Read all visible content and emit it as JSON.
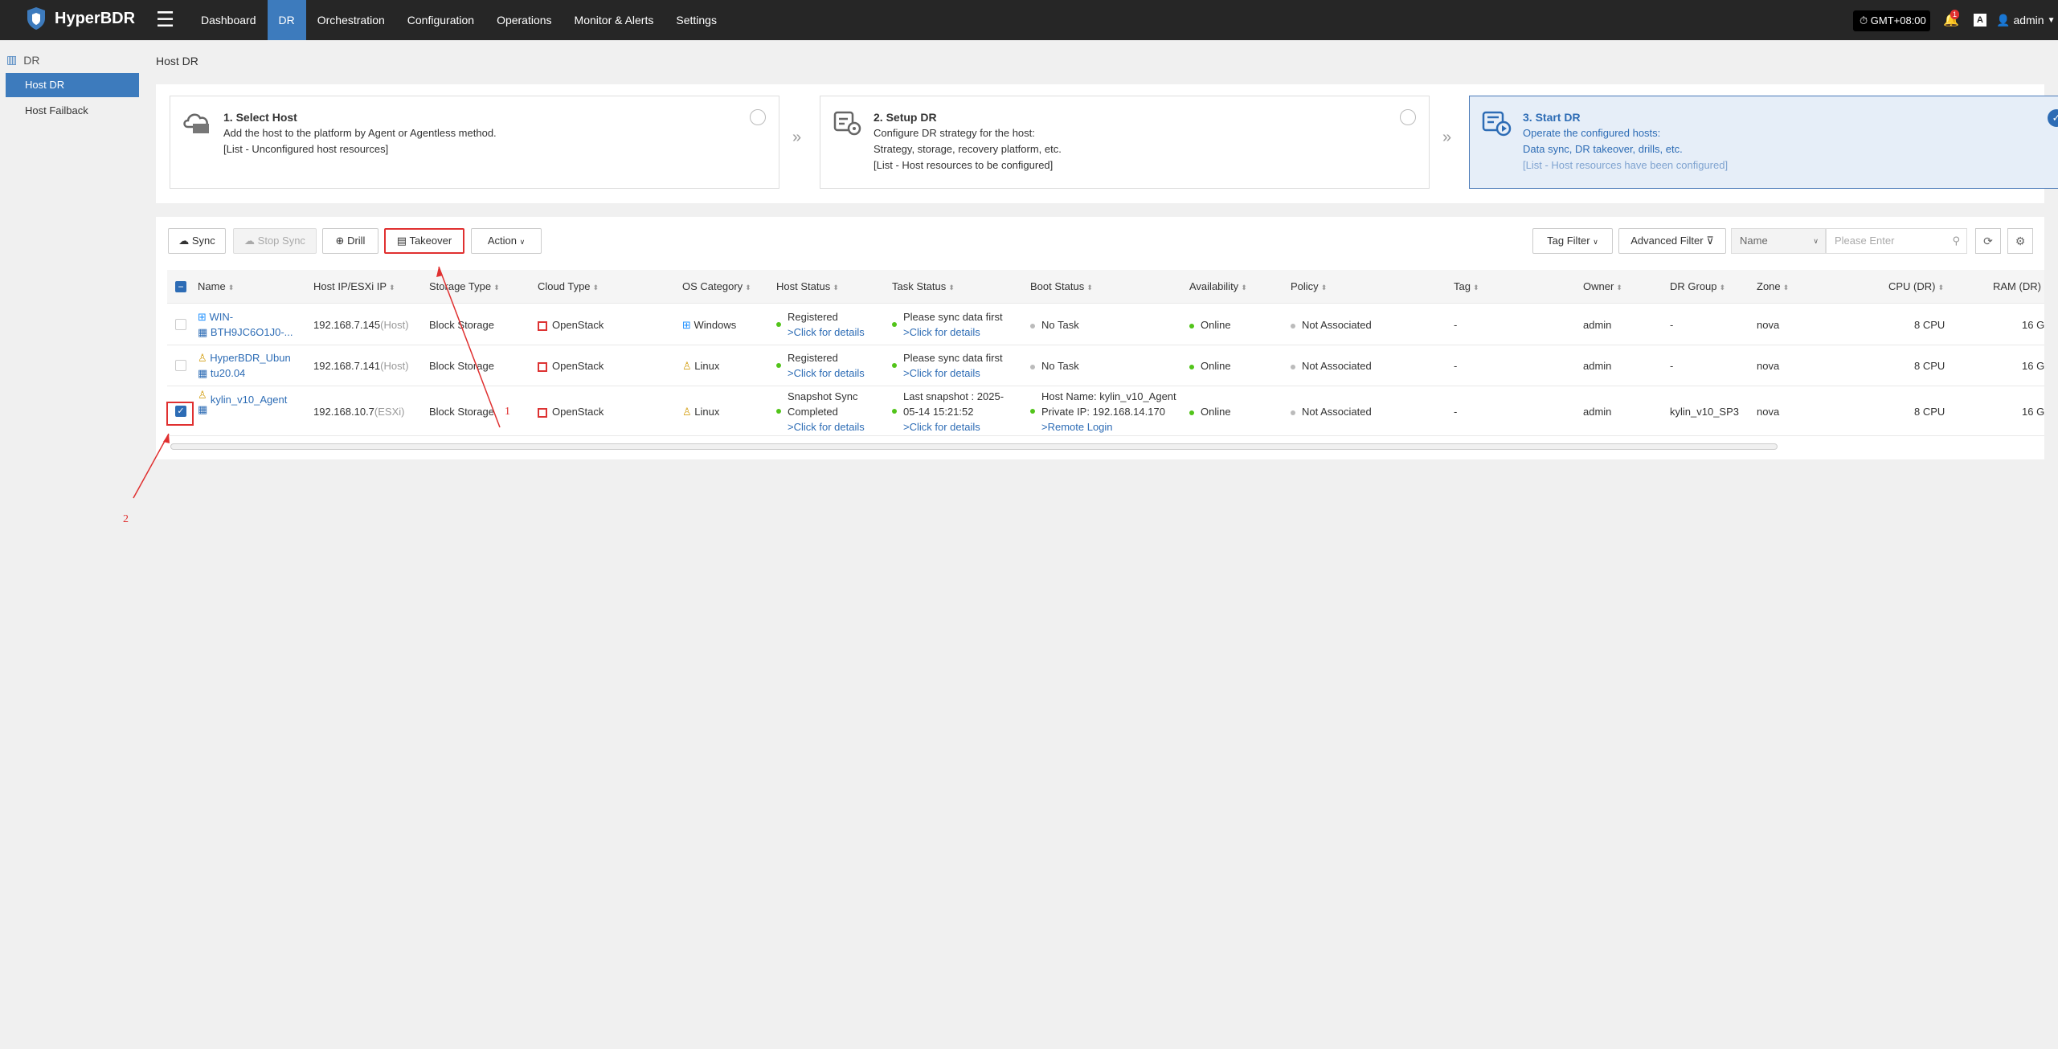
{
  "app": {
    "name": "HyperBDR"
  },
  "nav": [
    "Dashboard",
    "DR",
    "Orchestration",
    "Configuration",
    "Operations",
    "Monitor & Alerts",
    "Settings"
  ],
  "topright": {
    "timezone": "GMT+08:00",
    "alert_count": "1",
    "lang_icon": "A",
    "user": "admin"
  },
  "sidebar": {
    "header": "DR",
    "items": [
      "Host DR",
      "Host Failback"
    ]
  },
  "page": {
    "title": "Host DR"
  },
  "steps": [
    {
      "title": "1. Select Host",
      "line1": "Add the host to the platform by Agent or Agentless method.",
      "line2": "[List - Unconfigured host resources]",
      "line3": ""
    },
    {
      "title": "2. Setup DR",
      "line1": "Configure DR strategy for the host:",
      "line2": "Strategy, storage, recovery platform, etc.",
      "line3": "[List - Host resources to be configured]"
    },
    {
      "title": "3. Start DR",
      "line1": "Operate the configured hosts:",
      "line2": "Data sync, DR takeover, drills, etc.",
      "line3": "[List - Host resources have been configured]"
    }
  ],
  "toolbar": {
    "sync": "Sync",
    "stop_sync": "Stop Sync",
    "drill": "Drill",
    "takeover": "Takeover",
    "action": "Action",
    "tag_filter": "Tag Filter",
    "advanced_filter": "Advanced Filter",
    "search_field": "Name",
    "search_placeholder": "Please Enter"
  },
  "columns": [
    "Name",
    "Host IP/ESXi IP",
    "Storage Type",
    "Cloud Type",
    "OS Category",
    "Host Status",
    "Task Status",
    "Boot Status",
    "Availability",
    "Policy",
    "Tag",
    "Owner",
    "DR Group",
    "Zone",
    "CPU (DR)",
    "RAM (DR)"
  ],
  "rows": [
    {
      "name1": "WIN-",
      "name2": "BTH9JC6O1J0-...",
      "ip": "192.168.7.145",
      "ip_type": "(Host)",
      "storage": "Block Storage",
      "cloud": "OpenStack",
      "os": "Windows",
      "host_status1": "Registered",
      "host_status2": ">Click for details",
      "task1": "Please sync data first",
      "task2": ">Click for details",
      "boot1": "No Task",
      "boot2": "",
      "availability": "Online",
      "policy": "Not Associated",
      "tag": "-",
      "owner": "admin",
      "group": "-",
      "zone": "nova",
      "cpu": "8 CPU",
      "ram": "16 G",
      "checked": false
    },
    {
      "name1": "HyperBDR_Ubun",
      "name2": "tu20.04",
      "ip": "192.168.7.141",
      "ip_type": "(Host)",
      "storage": "Block Storage",
      "cloud": "OpenStack",
      "os": "Linux",
      "host_status1": "Registered",
      "host_status2": ">Click for details",
      "task1": "Please sync data first",
      "task2": ">Click for details",
      "boot1": "No Task",
      "boot2": "",
      "availability": "Online",
      "policy": "Not Associated",
      "tag": "-",
      "owner": "admin",
      "group": "-",
      "zone": "nova",
      "cpu": "8 CPU",
      "ram": "16 G",
      "checked": false
    },
    {
      "name1": "kylin_v10_Agent",
      "name2": "",
      "ip": "192.168.10.7",
      "ip_type": "(ESXi)",
      "storage": "Block Storage",
      "cloud": "OpenStack",
      "os": "Linux",
      "host_status1": "Snapshot Sync",
      "host_status1b": "Completed",
      "host_status2": ">Click for details",
      "task1": "Last snapshot : 2025-",
      "task1b": "05-14 15:21:52",
      "task2": ">Click for details",
      "boot1": "Host Name: kylin_v10_Agent",
      "boot1b": "Private IP: 192.168.14.170",
      "boot2": ">Remote Login",
      "availability": "Online",
      "policy": "Not Associated",
      "tag": "-",
      "owner": "admin",
      "group": "kylin_v10_SP3",
      "zone": "nova",
      "cpu": "8 CPU",
      "ram": "16 G",
      "checked": true
    }
  ],
  "annotations": {
    "a1": "1",
    "a2": "2"
  },
  "colors": {
    "accent": "#3d7bbd",
    "topbar": "#262626",
    "highlight": "#e03030",
    "online": "#52c41a"
  }
}
